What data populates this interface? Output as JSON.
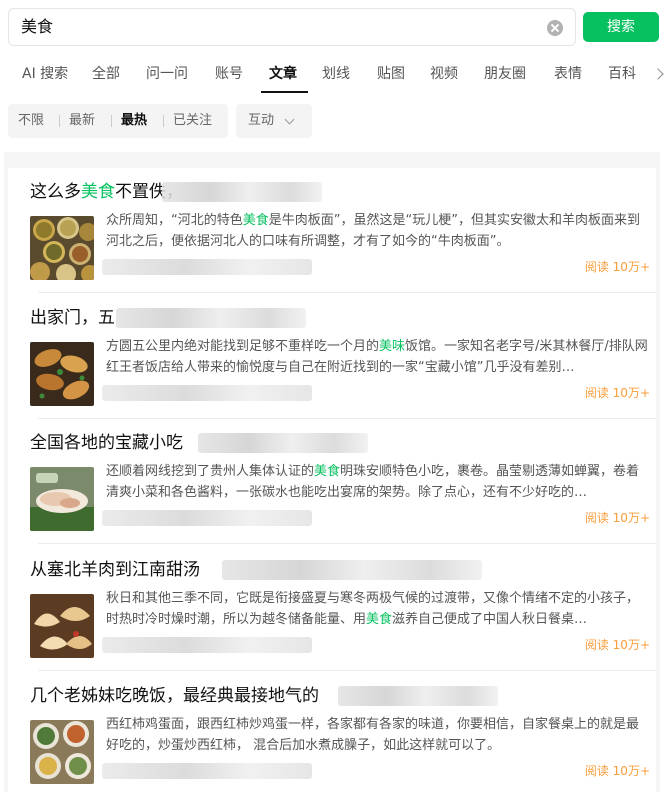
{
  "search": {
    "query": "美食",
    "button_label": "搜索"
  },
  "tabs": [
    "AI 搜索",
    "全部",
    "问一问",
    "账号",
    "文章",
    "划线",
    "贴图",
    "视频",
    "朋友圈",
    "表情",
    "百科"
  ],
  "active_tab": "文章",
  "filters": {
    "options": [
      "不限",
      "最新",
      "最热",
      "已关注"
    ],
    "active": "最热",
    "interaction_label": "互动"
  },
  "results": [
    {
      "title_pre": "这么多",
      "title_hl": "美食",
      "title_post": "不置佚，",
      "summary": [
        {
          "t": "众所周知，“河北的特色"
        },
        {
          "t": "美食",
          "hl": true
        },
        {
          "t": "是牛肉板面”，虽然这是“玩儿梗”，但其实安徽太和羊肉板面来到河北之后，便依据河北人的口味有所调整，才有了如今的“牛肉板面”。"
        }
      ],
      "reads": "阅读 10万+",
      "thumb": "spice-jars"
    },
    {
      "title_pre": "出家门，五",
      "title_hl": "",
      "title_post": "",
      "summary": [
        {
          "t": "方圆五公里内绝对能找到足够不重样吃一个月的"
        },
        {
          "t": "美味",
          "hl": true
        },
        {
          "t": "饭馆。一家知名老字号/米其林餐厅/排队网红王者饭店给人带来的愉悦度与自己在附近找到的一家“宝藏小馆”几乎没有差别…"
        }
      ],
      "reads": "阅读 10万+",
      "thumb": "fried-dumplings"
    },
    {
      "title_pre": "全国各地的宝藏小吃",
      "title_hl": "",
      "title_post": "",
      "summary": [
        {
          "t": "还顺着网线挖到了贵州人集体认证的"
        },
        {
          "t": "美食",
          "hl": true
        },
        {
          "t": "明珠安顺特色小吃，裹卷。晶莹剔透薄如蝉翼，卷着清爽小菜和各色酱料，一张碳水也能吃出宴席的架势。除了点心，还有不少好吃的…"
        }
      ],
      "reads": "阅读 10万+",
      "thumb": "rice-roll"
    },
    {
      "title_pre": "从塞北羊肉到江南甜汤",
      "title_hl": "",
      "title_post": "",
      "summary": [
        {
          "t": "秋日和其他三季不同，它既是衔接盛夏与寒冬两极气候的过渡带，又像个情绪不定的小孩子，时热时冷时燥时潮，所以为越冬储备能量、用"
        },
        {
          "t": "美食",
          "hl": true
        },
        {
          "t": "滋养自己便成了中国人秋日餐桌…"
        }
      ],
      "reads": "阅读 10万+",
      "thumb": "dumplings"
    },
    {
      "title_pre": "几个老姊妹吃晚饭，最经典最接地气的",
      "title_hl": "",
      "title_post": "",
      "summary": [
        {
          "t": "西红柿鸡蛋面，跟西红柿炒鸡蛋一样，各家都有各家的味道，你要相信，自家餐桌上的就是最好吃的，炒蛋炒西红柿， 混合后加水煮成臊子，如此这样就可以了。"
        }
      ],
      "reads": "阅读 10万+",
      "thumb": "home-dishes"
    }
  ]
}
